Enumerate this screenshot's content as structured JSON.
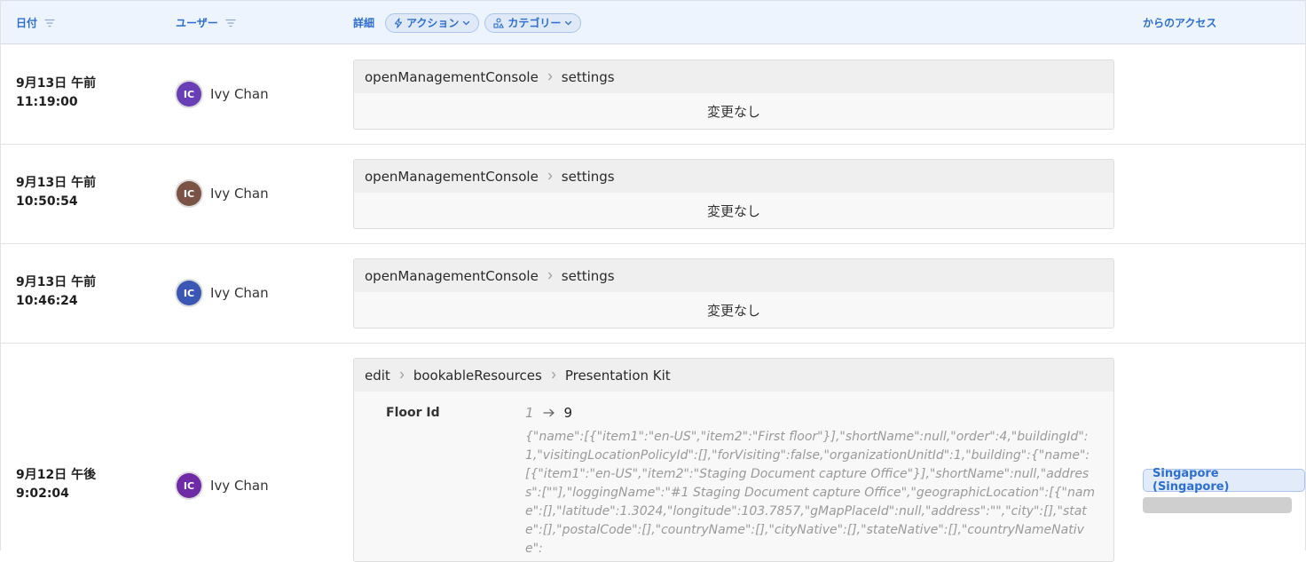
{
  "header": {
    "col_date": "日付",
    "col_user": "ユーザー",
    "col_detail": "詳細",
    "chip_action": "アクション",
    "chip_category": "カテゴリー",
    "col_access": "からのアクセス"
  },
  "rows": [
    {
      "date": "9月13日 午前",
      "time": "11:19:00",
      "initials": "IC",
      "avatar_color": "#6a3fb5",
      "user": "Ivy Chan",
      "crumbs": [
        "openManagementConsole",
        "settings"
      ],
      "nochange": "変更なし"
    },
    {
      "date": "9月13日 午前",
      "time": "10:50:54",
      "initials": "IC",
      "avatar_color": "#7b5345",
      "user": "Ivy Chan",
      "crumbs": [
        "openManagementConsole",
        "settings"
      ],
      "nochange": "変更なし"
    },
    {
      "date": "9月13日 午前",
      "time": "10:46:24",
      "initials": "IC",
      "avatar_color": "#3b57b4",
      "user": "Ivy Chan",
      "crumbs": [
        "openManagementConsole",
        "settings"
      ],
      "nochange": "変更なし"
    },
    {
      "date": "9月12日 午後",
      "time": "9:02:04",
      "initials": "IC",
      "avatar_color": "#6f2aa6",
      "user": "Ivy Chan",
      "crumbs": [
        "edit",
        "bookableResources",
        "Presentation Kit"
      ],
      "field": "Floor Id",
      "old_value": "1",
      "new_value": "9",
      "json": "{\"name\":[{\"item1\":\"en-US\",\"item2\":\"First floor\"}],\"shortName\":null,\"order\":4,\"buildingId\":1,\"visitingLocationPolicyId\":[],\"forVisiting\":false,\"organizationUnitId\":1,\"building\":{\"name\":[{\"item1\":\"en-US\",\"item2\":\"Staging Document capture Office\"}],\"shortName\":null,\"address\":[\"\"],\"loggingName\":\"#1 Staging Document capture Office\",\"geographicLocation\":[{\"name\":[],\"latitude\":1.3024,\"longitude\":103.7857,\"gMapPlaceId\":null,\"address\":\"\",\"city\":[],\"state\":[],\"postalCode\":[],\"countryName\":[],\"cityNative\":[],\"stateNative\":[],\"countryNameNative\":",
      "access_location": "Singapore (Singapore)"
    }
  ]
}
